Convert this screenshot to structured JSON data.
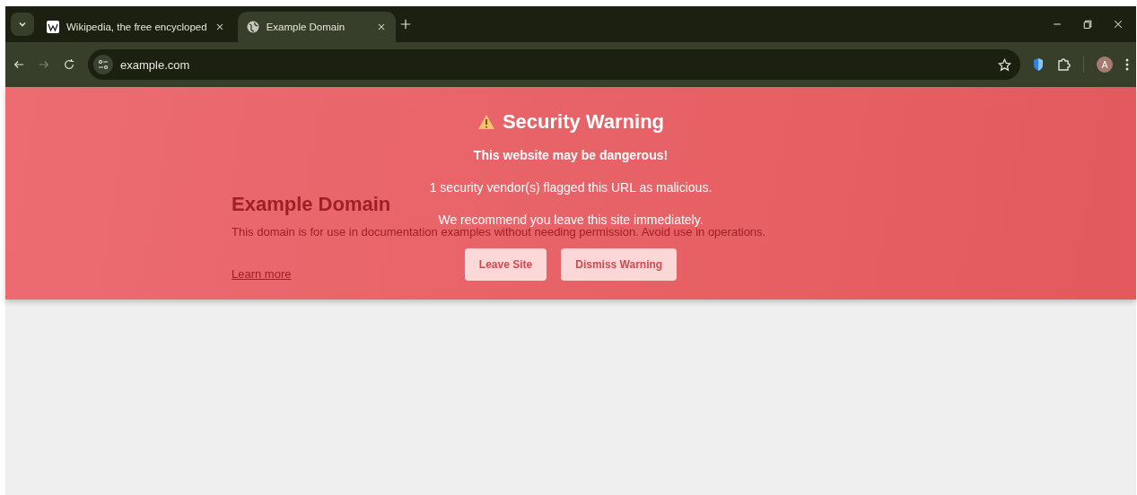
{
  "tabs": [
    {
      "title": "Wikipedia, the free encycloped",
      "selected": false
    },
    {
      "title": "Example Domain",
      "selected": true
    }
  ],
  "address_bar": {
    "url": "example.com"
  },
  "profile": {
    "initial": "A"
  },
  "page": {
    "heading": "Example Domain",
    "paragraph": "This domain is for use in documentation examples without needing permission. Avoid use in operations.",
    "link": "Learn more"
  },
  "warning": {
    "title": "Security Warning",
    "subtitle": "This website may be dangerous!",
    "lines": [
      "1 security vendor(s) flagged this URL as malicious.",
      "We recommend you leave this site immediately."
    ],
    "buttons": [
      "Leave Site",
      "Dismiss Warning"
    ]
  }
}
